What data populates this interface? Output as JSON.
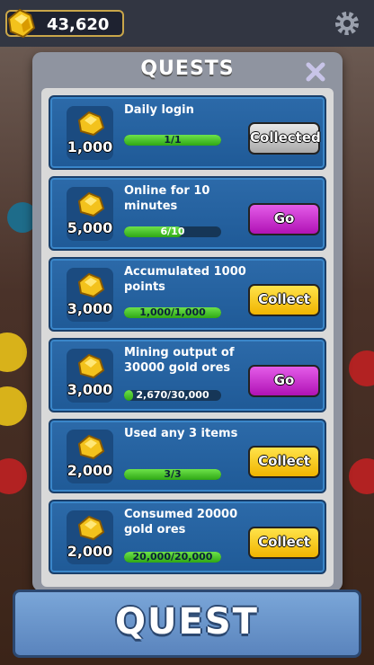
{
  "currency": {
    "amount": "43,620",
    "icon": "gold-ore-icon",
    "border_color": "#c9a64a"
  },
  "modal": {
    "title": "QUESTS"
  },
  "quests": [
    {
      "title": "Daily login",
      "reward": "1,000",
      "progress_text": "1/1",
      "progress": 1.0,
      "button": "Collected",
      "button_style": "collected"
    },
    {
      "title": "Online for 10 minutes",
      "reward": "5,000",
      "progress_text": "6/10",
      "progress": 0.6,
      "button": "Go",
      "button_style": "go"
    },
    {
      "title": "Accumulated 1000 points",
      "reward": "3,000",
      "progress_text": "1,000/1,000",
      "progress": 1.0,
      "button": "Collect",
      "button_style": "collect"
    },
    {
      "title": "Mining output of 30000 gold ores",
      "reward": "3,000",
      "progress_text": "2,670/30,000",
      "progress": 0.089,
      "button": "Go",
      "button_style": "go"
    },
    {
      "title": "Used any 3 items",
      "reward": "2,000",
      "progress_text": "3/3",
      "progress": 1.0,
      "button": "Collect",
      "button_style": "collect"
    },
    {
      "title": "Consumed 20000 gold ores",
      "reward": "2,000",
      "progress_text": "20,000/20,000",
      "progress": 1.0,
      "button": "Collect",
      "button_style": "collect"
    }
  ],
  "banner": {
    "label": "QUEST"
  },
  "colors": {
    "card": "#2c6aa9",
    "progress_green": "#2fa815",
    "go_button": "#b012b5",
    "collect_button": "#f0b400"
  }
}
